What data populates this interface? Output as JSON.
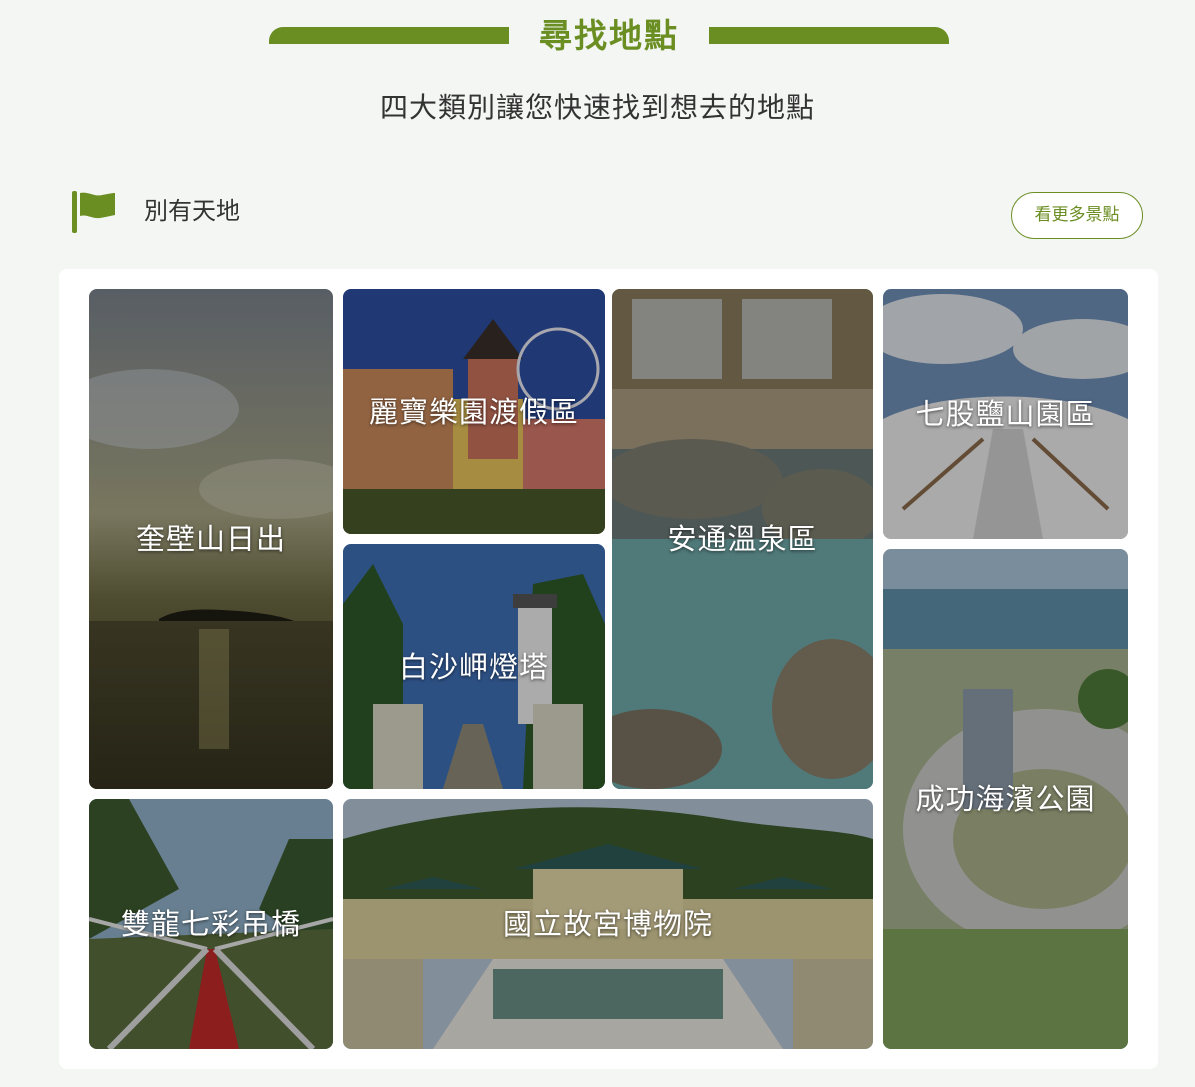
{
  "section": {
    "title": "尋找地點",
    "subtitle": "四大類別讓您快速找到想去的地點"
  },
  "category": {
    "label": "別有天地",
    "more_label": "看更多景點",
    "icon": "flag-icon",
    "accent": "#6b8e23"
  },
  "places": [
    {
      "id": "kuibishan",
      "name": "奎壁山日出"
    },
    {
      "id": "lihpao",
      "name": "麗寶樂園渡假區"
    },
    {
      "id": "baishajia",
      "name": "白沙岬燈塔"
    },
    {
      "id": "antong",
      "name": "安通溫泉區"
    },
    {
      "id": "qigu",
      "name": "七股鹽山園區"
    },
    {
      "id": "chenggong",
      "name": "成功海濱公園"
    },
    {
      "id": "shuanglong",
      "name": "雙龍七彩吊橋"
    },
    {
      "id": "palace",
      "name": "國立故宮博物院"
    }
  ]
}
